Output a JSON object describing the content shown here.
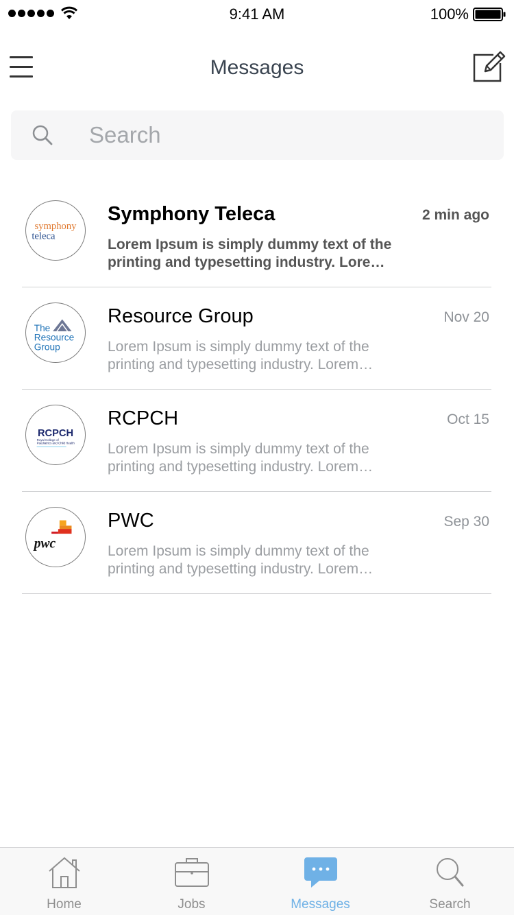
{
  "status_bar": {
    "time": "9:41 AM",
    "battery": "100%"
  },
  "nav": {
    "title": "Messages",
    "menu_icon": "hamburger-menu-icon",
    "compose_icon": "compose-icon"
  },
  "search": {
    "placeholder": "Search",
    "value": "",
    "icon": "search-icon"
  },
  "messages": [
    {
      "sender": "Symphony Teleca",
      "time": "2 min ago",
      "preview": "Lorem Ipsum is simply dummy text of the printing and typesetting industry. Lorem Ipsum has been the industry's standard dummy text.",
      "unread": true,
      "avatar_text": [
        "symphony",
        "teleca"
      ]
    },
    {
      "sender": "Resource Group",
      "time": "Nov 20",
      "preview": "Lorem Ipsum is simply dummy text of the printing and typesetting industry. Lorem Ipsum has been the industry's standard dummy text.",
      "unread": false,
      "avatar_text": [
        "The",
        "Resource",
        "Group"
      ]
    },
    {
      "sender": "RCPCH",
      "time": "Oct 15",
      "preview": "Lorem Ipsum is simply dummy text of the printing and typesetting industry. Lorem Ipsum has been the industry's standard dummy text.",
      "unread": false,
      "avatar_text": [
        "RCPCH",
        "Royal College of",
        "Paediatrics and Child Health"
      ]
    },
    {
      "sender": "PWC",
      "time": "Sep 30",
      "preview": "Lorem Ipsum is simply dummy text of the printing and typesetting industry. Lorem Ipsum has been the industry's standard dummy text.",
      "unread": false,
      "avatar_text": [
        "pwc"
      ]
    }
  ],
  "tabs": [
    {
      "label": "Home",
      "icon": "home-icon",
      "active": false
    },
    {
      "label": "Jobs",
      "icon": "briefcase-icon",
      "active": false
    },
    {
      "label": "Messages",
      "icon": "chat-bubble-icon",
      "active": true
    },
    {
      "label": "Search",
      "icon": "search-icon",
      "active": false
    }
  ],
  "colors": {
    "accent": "#6fb1e6",
    "divider": "#cfd0d2",
    "muted_text": "#9a9da1",
    "title_text": "#3a4450"
  }
}
